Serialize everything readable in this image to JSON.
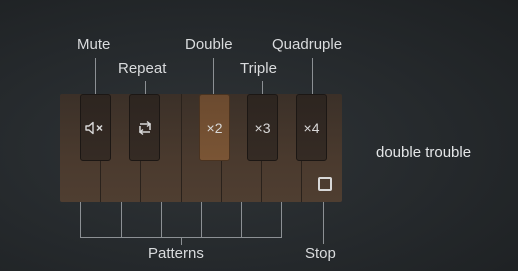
{
  "labels": {
    "mute": "Mute",
    "repeat": "Repeat",
    "double": "Double",
    "triple": "Triple",
    "quadruple": "Quadruple",
    "patterns": "Patterns",
    "stop": "Stop"
  },
  "keys": {
    "repeat_icon": "repeat-icon",
    "mute_icon": "mute-icon",
    "double_label": "×2",
    "triple_label": "×3",
    "quadruple_label": "×4",
    "stop_icon": "stop-icon"
  },
  "title": "double trouble",
  "colors": {
    "highlight_key": "#7a5535",
    "background": "#25292c"
  }
}
